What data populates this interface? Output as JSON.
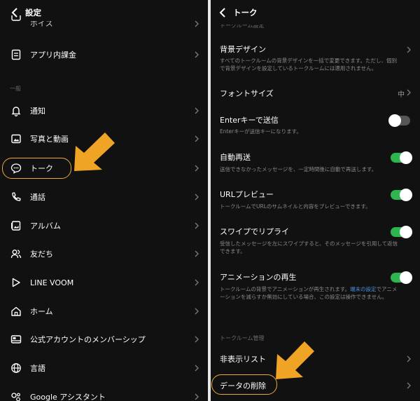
{
  "left": {
    "title": "設定",
    "cut_item": "ボイス",
    "items": [
      {
        "label": "アプリ内課金",
        "icon": "receipt-icon"
      },
      {
        "label": "通知",
        "icon": "bell-icon"
      },
      {
        "label": "写真と動画",
        "icon": "photo-icon"
      },
      {
        "label": "トーク",
        "icon": "chat-bubble-icon"
      },
      {
        "label": "通話",
        "icon": "phone-icon"
      },
      {
        "label": "アルバム",
        "icon": "album-icon"
      },
      {
        "label": "友だち",
        "icon": "friends-icon"
      },
      {
        "label": "LINE VOOM",
        "icon": "voom-play-icon"
      },
      {
        "label": "ホーム",
        "icon": "home-icon"
      },
      {
        "label": "公式アカウントのメンバーシップ",
        "icon": "membership-icon"
      },
      {
        "label": "言語",
        "icon": "globe-icon"
      },
      {
        "label": "Google アシスタント",
        "icon": "assistant-icon"
      }
    ],
    "section_general": "一般"
  },
  "right": {
    "title": "トーク",
    "section_top_cut": "トークルーム設定",
    "bg_title": "背景デザイン",
    "bg_desc": "すべてのトークルームの背景デザインを一括で変更できます。ただし、個別で背景デザインを設定しているトークルームには適用されません。",
    "font_title": "フォントサイズ",
    "font_value": "中",
    "enter_title": "Enterキーで送信",
    "enter_desc": "Enterキーが送信キーになります。",
    "enter_on": false,
    "resend_title": "自動再送",
    "resend_desc": "送信できなかったメッセージを、一定時間後に自動で再送します。",
    "resend_on": true,
    "url_title": "URLプレビュー",
    "url_desc": "トークルームでURLのサムネイルと内容をプレビューできます。",
    "url_on": true,
    "swipe_title": "スワイプでリプライ",
    "swipe_desc": "受信したメッセージを左にスワイプすると、そのメッセージを引用して返信できます。",
    "swipe_on": true,
    "anim_title": "アニメーションの再生",
    "anim_desc_a": "トークルームの背景でアニメーションが再生されます。",
    "anim_desc_link": "端末の設定",
    "anim_desc_b": "でアニメーションを減らすか無効にしている場合、この設定は操作できません。",
    "anim_on": true,
    "section_manage": "トークルーム管理",
    "hidden_title": "非表示リスト",
    "delete_title": "データの削除"
  },
  "colors": {
    "accent": "#e8a93a",
    "toggle_on": "#2fb550",
    "link": "#4a8fe0",
    "background": "#111111"
  }
}
